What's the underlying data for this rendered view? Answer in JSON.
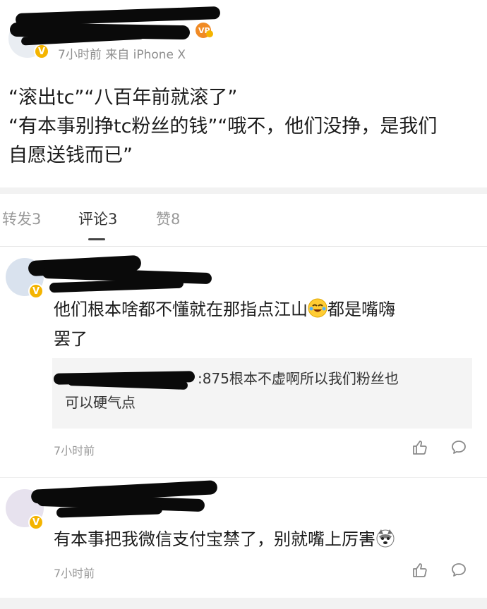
{
  "post": {
    "meta": "7小时前 来自 iPhone X",
    "text_lines": [
      "“滚出tc”“八百年前就滚了”",
      "“有本事别挣tc粉丝的钱”“哦不，他们没挣，是我们",
      "自愿送钱而已”"
    ]
  },
  "tabs": [
    {
      "label": "转发3"
    },
    {
      "label": "评论3"
    },
    {
      "label": "赞8"
    }
  ],
  "comments": [
    {
      "text_part1": "他们根本啥都不懂就在那指点江山",
      "emoji": "laugh-cry-emoji",
      "text_part2": "都是嘴嗨",
      "text_line2": "罢了",
      "reply_line1": ":875根本不虚啊所以我们粉丝也",
      "reply_line2": "可以硬气点",
      "time": "7小时前"
    },
    {
      "text": "有本事把我微信支付宝禁了，别就嘴上厉害",
      "emoji": "husky-emoji",
      "time": "7小时前"
    }
  ],
  "colors": {
    "vip_badge": "#f4b400",
    "page_bg": "#ffffff",
    "band": "#f2f2f2"
  }
}
